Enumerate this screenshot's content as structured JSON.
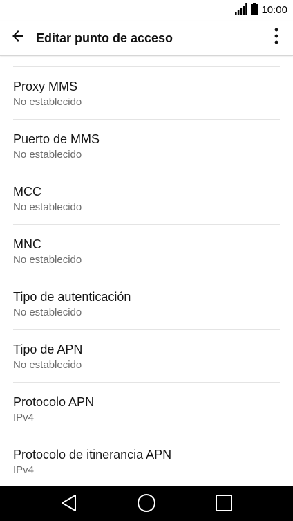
{
  "status_bar": {
    "time": "10:00",
    "icons": [
      "signal-icon",
      "battery-icon"
    ]
  },
  "app_bar": {
    "title": "Editar punto de acceso",
    "back_icon": "arrow-back-icon",
    "menu_icon": "more-vert-icon"
  },
  "settings": {
    "items": [
      {
        "title": "Proxy MMS",
        "value": "No establecido"
      },
      {
        "title": "Puerto de MMS",
        "value": "No establecido"
      },
      {
        "title": "MCC",
        "value": "No establecido"
      },
      {
        "title": "MNC",
        "value": "No establecido"
      },
      {
        "title": "Tipo de autenticación",
        "value": "No establecido"
      },
      {
        "title": "Tipo de APN",
        "value": "No establecido"
      },
      {
        "title": "Protocolo APN",
        "value": "IPv4"
      },
      {
        "title": "Protocolo de itinerancia APN",
        "value": "IPv4"
      }
    ]
  },
  "nav_bar": {
    "icons": [
      "back-triangle-icon",
      "home-circle-icon",
      "recents-square-icon"
    ]
  }
}
